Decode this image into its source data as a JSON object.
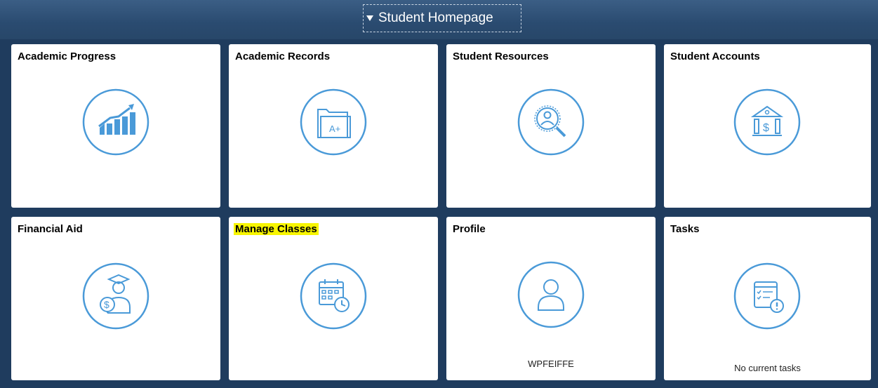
{
  "header": {
    "homepage_label": "Student Homepage",
    "caret_icon": "caret-down-icon"
  },
  "tiles": [
    {
      "title": "Academic Progress",
      "icon": "chart-trend-up-icon"
    },
    {
      "title": "Academic Records",
      "icon": "folder-grade-icon"
    },
    {
      "title": "Student Resources",
      "icon": "search-person-icon"
    },
    {
      "title": "Student Accounts",
      "icon": "bank-dollar-icon"
    },
    {
      "title": "Financial Aid",
      "icon": "graduate-dollar-icon"
    },
    {
      "title": "Manage Classes",
      "icon": "calendar-clock-icon"
    },
    {
      "title": "Profile",
      "icon": "person-icon",
      "footer": "WPFEIFFE"
    },
    {
      "title": "Tasks",
      "icon": "task-list-alert-icon",
      "footer": "No current tasks"
    }
  ],
  "colors": {
    "background": "#1f3c5e",
    "header": "#2f5277",
    "icon_stroke": "#4a9ad8",
    "highlight": "#f7f500"
  }
}
